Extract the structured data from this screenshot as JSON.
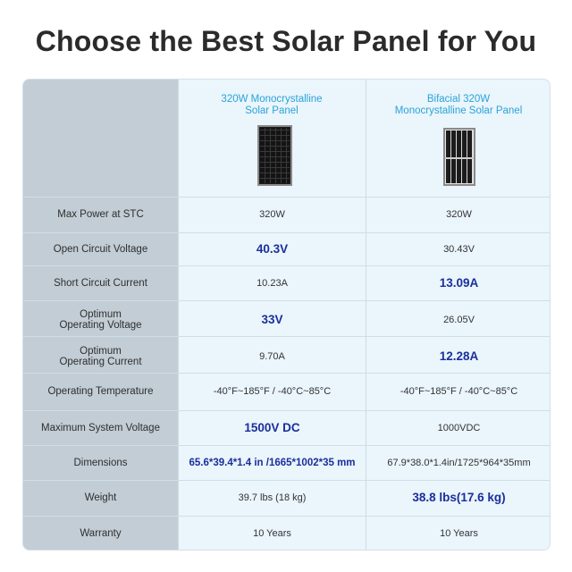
{
  "title": "Choose the Best Solar Panel for You",
  "columns": [
    {
      "name_line1": "320W Monocrystalline",
      "name_line2": "Solar Panel"
    },
    {
      "name_line1": "Bifacial 320W",
      "name_line2": "Monocrystalline Solar Panel"
    }
  ],
  "rows": [
    {
      "label_line1": "Max Power at STC",
      "label_line2": "",
      "a": "320W",
      "b": "320W",
      "highlight": "none"
    },
    {
      "label_line1": "Open Circuit Voltage",
      "label_line2": "",
      "a": "40.3V",
      "b": "30.43V",
      "highlight": "a"
    },
    {
      "label_line1": "Short Circuit Current",
      "label_line2": "",
      "a": "10.23A",
      "b": "13.09A",
      "highlight": "b"
    },
    {
      "label_line1": "Optimum",
      "label_line2": "Operating Voltage",
      "a": "33V",
      "b": "26.05V",
      "highlight": "a"
    },
    {
      "label_line1": "Optimum",
      "label_line2": "Operating Current",
      "a": "9.70A",
      "b": "12.28A",
      "highlight": "b"
    },
    {
      "label_line1": "Operating Temperature",
      "label_line2": "",
      "a": "-40°F~185°F / -40°C~85°C",
      "b": "-40°F~185°F / -40°C~85°C",
      "highlight": "none"
    },
    {
      "label_line1": "Maximum System Voltage",
      "label_line2": "",
      "a": "1500V DC",
      "b": "1000VDC",
      "highlight": "a"
    },
    {
      "label_line1": "Dimensions",
      "label_line2": "",
      "a": "65.6*39.4*1.4 in /1665*1002*35 mm",
      "b": "67.9*38.0*1.4in/1725*964*35mm",
      "highlight": "a"
    },
    {
      "label_line1": "Weight",
      "label_line2": "",
      "a": "39.7 lbs (18 kg)",
      "b": "38.8 lbs(17.6 kg)",
      "highlight": "b"
    },
    {
      "label_line1": "Warranty",
      "label_line2": "",
      "a": "10 Years",
      "b": "10 Years",
      "highlight": "none"
    }
  ],
  "colors": {
    "accent_header": "#2aa3d8",
    "highlight_text": "#1a2f9a",
    "label_column": "#c2cdd5",
    "table_background": "#eaf5fc"
  }
}
